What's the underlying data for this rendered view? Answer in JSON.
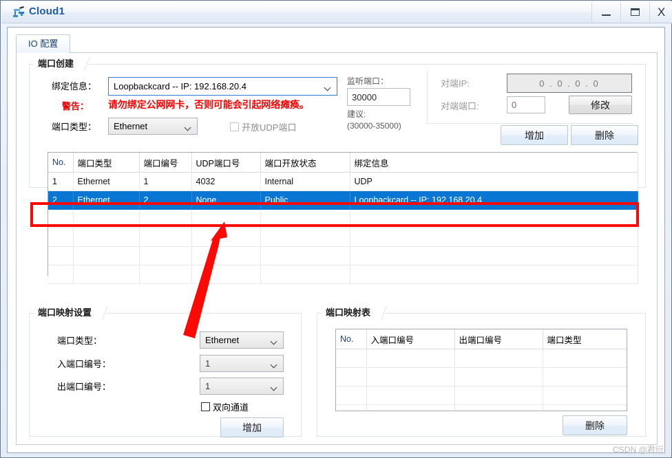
{
  "window": {
    "title": "Cloud1",
    "icon": "cloud-network-icon",
    "minimize_label": "–",
    "maximize_label": "□",
    "close_label": "X"
  },
  "tabs": [
    {
      "label": "IO 配置",
      "active": true
    }
  ],
  "port_create": {
    "title": "端口创建",
    "binding_label": "绑定信息：",
    "binding_value": "Loopbackcard -- IP: 192.168.20.4",
    "warning_label": "警告：",
    "warning_text": "请勿绑定公网网卡，否则可能会引起网络瘫痪。",
    "port_type_label": "端口类型：",
    "port_type_value": "Ethernet",
    "open_udp_label": "开放UDP端口",
    "open_udp_checked": false,
    "listen_port_label": "监听端口：",
    "listen_port_value": "30000",
    "suggest_label": "建议:",
    "suggest_range": "(30000-35000)",
    "peer_ip_label": "对端IP:",
    "peer_ip_value": "0 . 0 . 0 . 0",
    "peer_port_label": "对端端口:",
    "peer_port_value": "0",
    "modify_button": "修改",
    "add_button": "增加",
    "delete_button": "删除"
  },
  "port_table": {
    "columns": [
      "No.",
      "端口类型",
      "端口编号",
      "UDP端口号",
      "端口开放状态",
      "绑定信息"
    ],
    "rows": [
      {
        "no": "1",
        "port_type": "Ethernet",
        "port_no": "1",
        "udp_port": "4032",
        "state": "Internal",
        "binding": "UDP",
        "selected": false
      },
      {
        "no": "2",
        "port_type": "Ethernet",
        "port_no": "2",
        "udp_port": "None",
        "state": "Public",
        "binding": "Loopbackcard -- IP: 192.168.20.4",
        "selected": true
      }
    ],
    "empty_row_count": 4
  },
  "mapping_settings": {
    "title": "端口映射设置",
    "port_type_label": "端口类型：",
    "port_type_value": "Ethernet",
    "in_port_label": "入端口编号：",
    "in_port_value": "1",
    "out_port_label": "出端口编号：",
    "out_port_value": "1",
    "duplex_label": "双向通道",
    "duplex_checked": false,
    "add_button": "增加"
  },
  "mapping_table": {
    "title": "端口映射表",
    "columns": [
      "No.",
      "入端口编号",
      "出端口编号",
      "端口类型"
    ],
    "rows": [],
    "empty_row_count": 5,
    "delete_button": "删除"
  },
  "annotation": {
    "highlight_color": "#fb0a05",
    "arrow_color": "#fb0a05",
    "target": "selected table row 2"
  },
  "watermark": "CSDN @君衍."
}
